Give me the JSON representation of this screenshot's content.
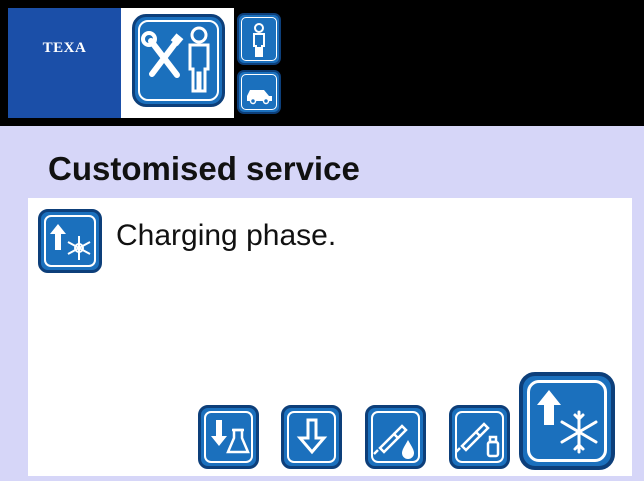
{
  "header": {
    "brand": "TEXA",
    "mode_icon": "service-technician-icon",
    "small_buttons": [
      {
        "name": "person-icon"
      },
      {
        "name": "car-icon"
      }
    ]
  },
  "page": {
    "title": "Customised service"
  },
  "status": {
    "icon": "charging-snowflake-icon",
    "text": "Charging phase."
  },
  "toolbar": {
    "buttons": [
      {
        "name": "recovery-button",
        "icon": "arrow-down-flask-icon"
      },
      {
        "name": "vacuum-button",
        "icon": "arrow-down-icon"
      },
      {
        "name": "oil-injection-button",
        "icon": "dropper-drop-icon"
      },
      {
        "name": "uv-tracer-button",
        "icon": "dropper-bottle-icon"
      },
      {
        "name": "charge-button",
        "icon": "arrow-up-snowflake-icon"
      }
    ]
  },
  "colors": {
    "background": "#d6d6f8",
    "topbar": "#000000",
    "brand_blue": "#1b4fa8",
    "button_blue": "#1b70bd",
    "button_border": "#0d3f7a",
    "panel": "#ffffff"
  }
}
